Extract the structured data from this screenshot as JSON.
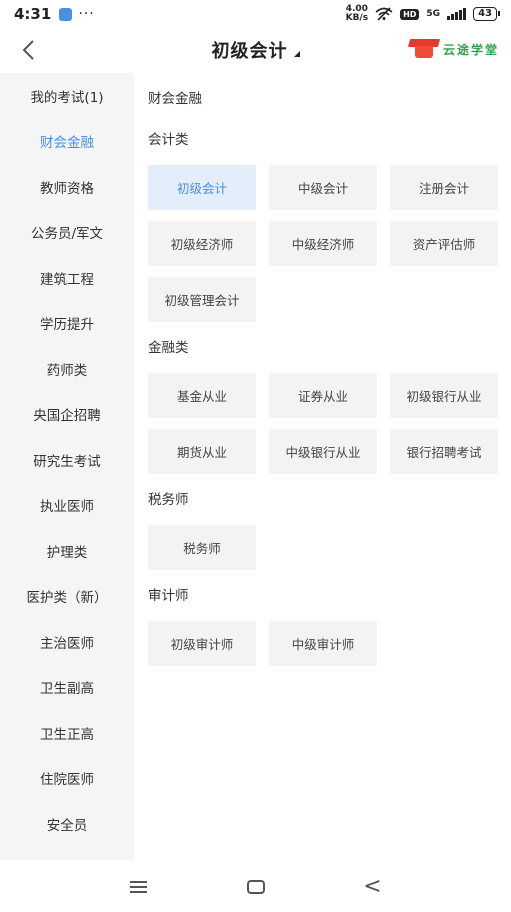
{
  "status_bar": {
    "time": "4:31",
    "dots": "···",
    "net_speed_value": "4.00",
    "net_speed_unit": "KB/s",
    "hd": "HD",
    "network": "5G",
    "battery": "43"
  },
  "header": {
    "back_glyph": "‹",
    "title": "初级会计",
    "brand_name": "云途学堂"
  },
  "sidebar": {
    "items": [
      {
        "label": "我的考试(1)"
      },
      {
        "label": "财会金融"
      },
      {
        "label": "教师资格"
      },
      {
        "label": "公务员/军文"
      },
      {
        "label": "建筑工程"
      },
      {
        "label": "学历提升"
      },
      {
        "label": "药师类"
      },
      {
        "label": "央国企招聘"
      },
      {
        "label": "研究生考试"
      },
      {
        "label": "执业医师"
      },
      {
        "label": "护理类"
      },
      {
        "label": "医护类（新）"
      },
      {
        "label": "主治医师"
      },
      {
        "label": "卫生副高"
      },
      {
        "label": "卫生正高"
      },
      {
        "label": "住院医师"
      },
      {
        "label": "安全员"
      }
    ],
    "active_index": 1
  },
  "main": {
    "category_title": "财会金融",
    "sections": [
      {
        "title": "会计类",
        "items": [
          "初级会计",
          "中级会计",
          "注册会计",
          "初级经济师",
          "中级经济师",
          "资产评估师",
          "初级管理会计"
        ]
      },
      {
        "title": "金融类",
        "items": [
          "基金从业",
          "证券从业",
          "初级银行从业",
          "期货从业",
          "中级银行从业",
          "银行招聘考试"
        ]
      },
      {
        "title": "税务师",
        "items": [
          "税务师"
        ]
      },
      {
        "title": "审计师",
        "items": [
          "初级审计师",
          "中级审计师"
        ]
      }
    ],
    "selected_item": "初级会计"
  },
  "colors": {
    "accent": "#4a8ee6",
    "selected_tile_bg": "#e4eefb",
    "brand_green": "#2ea34f",
    "brand_red": "#e33b2e"
  },
  "navbar": {
    "icons": [
      "menu-icon",
      "home-icon",
      "back-icon"
    ],
    "back_glyph": "<"
  }
}
